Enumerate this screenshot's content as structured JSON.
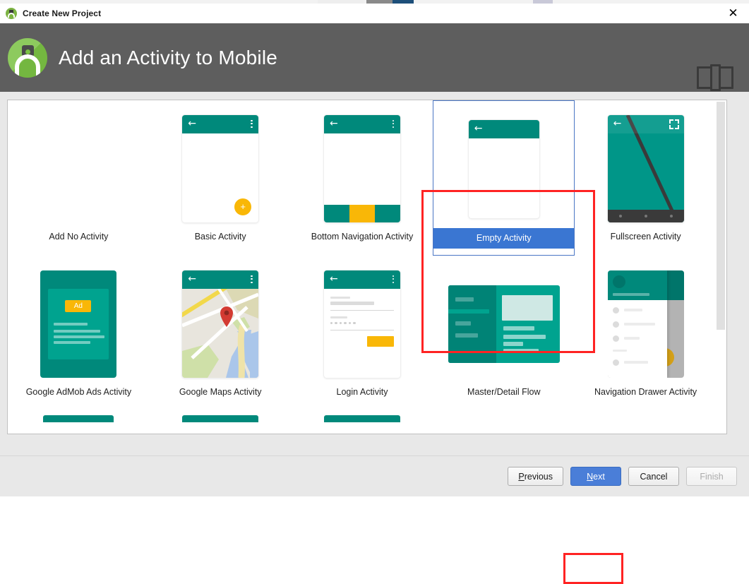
{
  "window": {
    "title": "Create New Project",
    "app_icon": "android-studio-icon",
    "close_icon": "close-icon"
  },
  "header": {
    "title": "Add an Activity to Mobile",
    "logo_icon": "android-studio-logo",
    "device_icon": "tablet-phone-form-factor-icon",
    "background_color": "#5e5e5e"
  },
  "colors": {
    "accent_green": "#00897b",
    "accent_amber": "#f9b707",
    "selection_blue": "#3a76d2",
    "highlight_red": "#ff2323",
    "header_gray": "#5e5e5e"
  },
  "templates": {
    "rows": [
      [
        {
          "id": "add-no-activity",
          "label": "Add No Activity",
          "thumb": "none",
          "selected": false
        },
        {
          "id": "basic-activity",
          "label": "Basic Activity",
          "thumb": "basic",
          "selected": false
        },
        {
          "id": "bottom-navigation-activity",
          "label": "Bottom Navigation Activity",
          "thumb": "bottomnav",
          "selected": false
        },
        {
          "id": "empty-activity",
          "label": "Empty Activity",
          "thumb": "empty",
          "selected": true
        },
        {
          "id": "fullscreen-activity",
          "label": "Fullscreen Activity",
          "thumb": "fullscreen",
          "selected": false
        }
      ],
      [
        {
          "id": "google-admob-ads-activity",
          "label": "Google AdMob Ads Activity",
          "thumb": "admob",
          "selected": false
        },
        {
          "id": "google-maps-activity",
          "label": "Google Maps Activity",
          "thumb": "maps",
          "selected": false
        },
        {
          "id": "login-activity",
          "label": "Login Activity",
          "thumb": "login",
          "selected": false
        },
        {
          "id": "master-detail-flow",
          "label": "Master/Detail Flow",
          "thumb": "masterdetail",
          "selected": false
        },
        {
          "id": "navigation-drawer-activity",
          "label": "Navigation Drawer Activity",
          "thumb": "navdrawer",
          "selected": false
        }
      ]
    ],
    "admob_badge_label": "Ad",
    "fab_label": "+"
  },
  "scrollbar": {
    "orientation": "vertical",
    "thumb_position": "top"
  },
  "footer": {
    "previous": {
      "label": "Previous",
      "mnemonic": "P",
      "state": "enabled"
    },
    "next": {
      "label": "Next",
      "mnemonic": "N",
      "state": "enabled-primary-highlighted"
    },
    "cancel": {
      "label": "Cancel",
      "mnemonic": "",
      "state": "enabled"
    },
    "finish": {
      "label": "Finish",
      "mnemonic": "",
      "state": "disabled"
    }
  }
}
